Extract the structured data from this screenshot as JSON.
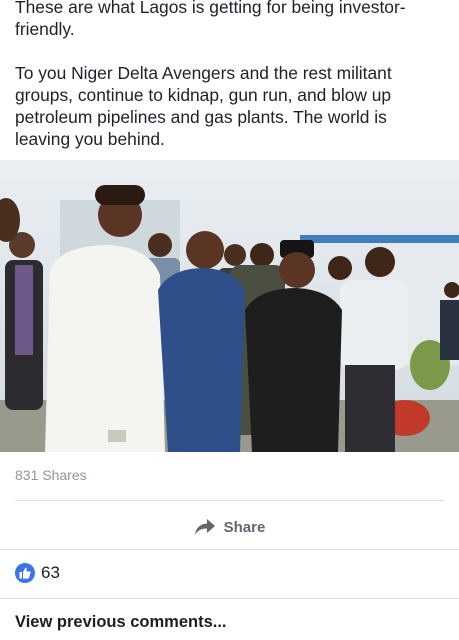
{
  "post": {
    "paragraph_1": "These are what Lagos is getting for being investor-friendly.",
    "paragraph_2": "To you Niger Delta Avengers and the rest militant groups, continue to kidnap, gun run, and blow up petroleum pipelines and gas plants. The world is leaving you behind."
  },
  "stats": {
    "shares_label": "831 Shares",
    "likes_count": "63"
  },
  "actions": {
    "share_label": "Share",
    "view_previous_comments": "View previous comments..."
  },
  "colors": {
    "like_blue": "#3b74e8",
    "muted_text": "#90949c",
    "divider": "#dddfe2"
  },
  "icons": {
    "share": "share-arrow-icon",
    "like": "thumbs-up-icon"
  }
}
